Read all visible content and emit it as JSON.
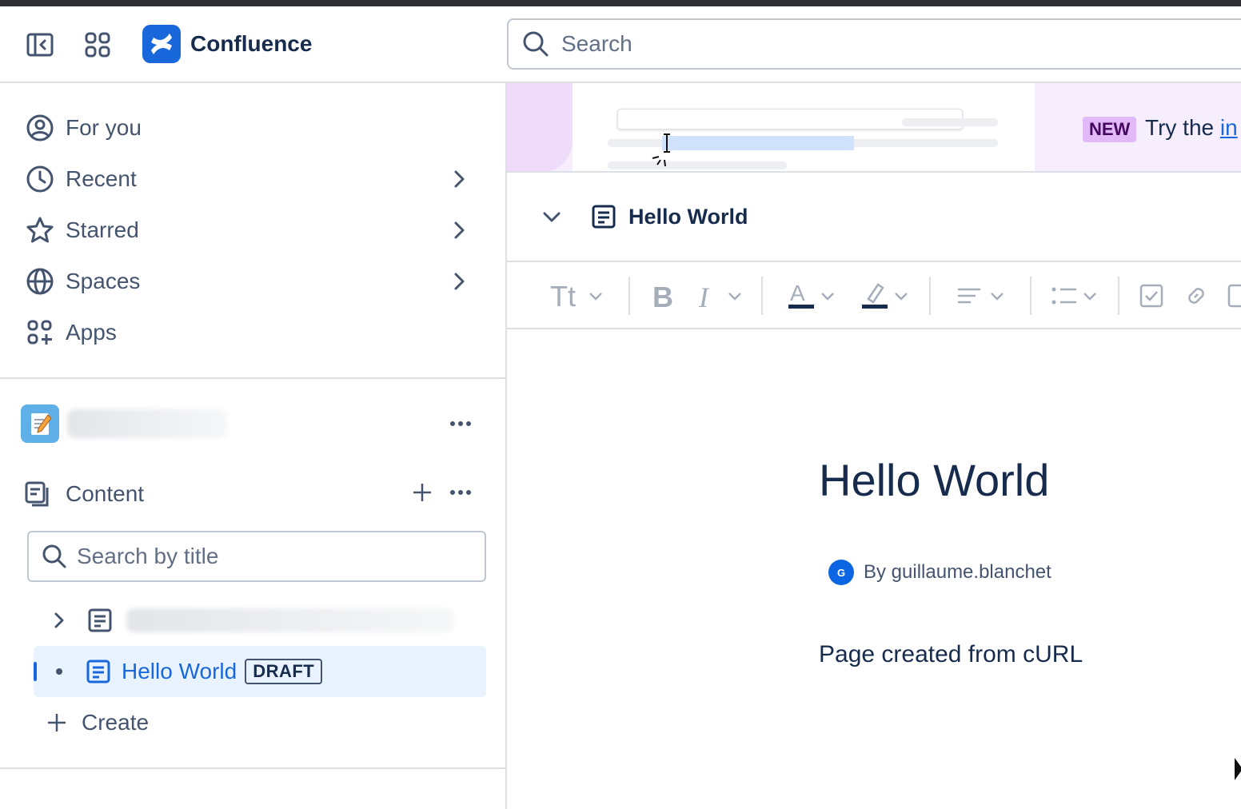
{
  "app": {
    "name": "Confluence"
  },
  "colors": {
    "brand": "#1868db",
    "link": "#1868db",
    "selected_bg": "#e9f2ff",
    "new_badge": "#e2b9f7"
  },
  "header": {
    "search_placeholder": "Search",
    "icons": [
      "sidebar-toggle-icon",
      "app-switcher-icon",
      "confluence-logo-icon",
      "search-icon"
    ]
  },
  "sidebar": {
    "nav": [
      {
        "label": "For you",
        "icon": "user-circle-icon",
        "expandable": false
      },
      {
        "label": "Recent",
        "icon": "clock-icon",
        "expandable": true
      },
      {
        "label": "Starred",
        "icon": "star-icon",
        "expandable": true
      },
      {
        "label": "Spaces",
        "icon": "globe-icon",
        "expandable": true
      },
      {
        "label": "Apps",
        "icon": "apps-add-icon",
        "expandable": false
      }
    ],
    "space": {
      "icon": "notepad-icon"
    },
    "content": {
      "label": "Content",
      "search_placeholder": "Search by title",
      "tree": [
        {
          "title": "",
          "selected": false
        },
        {
          "title": "Hello World",
          "badge": "DRAFT",
          "selected": true
        }
      ],
      "create_label": "Create"
    }
  },
  "banner": {
    "badge": "NEW",
    "text": "Try the ",
    "link": "in"
  },
  "page": {
    "breadcrumb_title": "Hello World",
    "toolbar": [
      "text-style-icon",
      "bold-icon",
      "italic-icon",
      "text-color-icon",
      "highlight-icon",
      "align-icon",
      "list-icon",
      "checkbox-icon",
      "link-icon",
      "image-icon"
    ],
    "title": "Hello World",
    "author_initial": "G",
    "byline": "By guillaume.blanchet",
    "body": "Page created from cURL"
  }
}
